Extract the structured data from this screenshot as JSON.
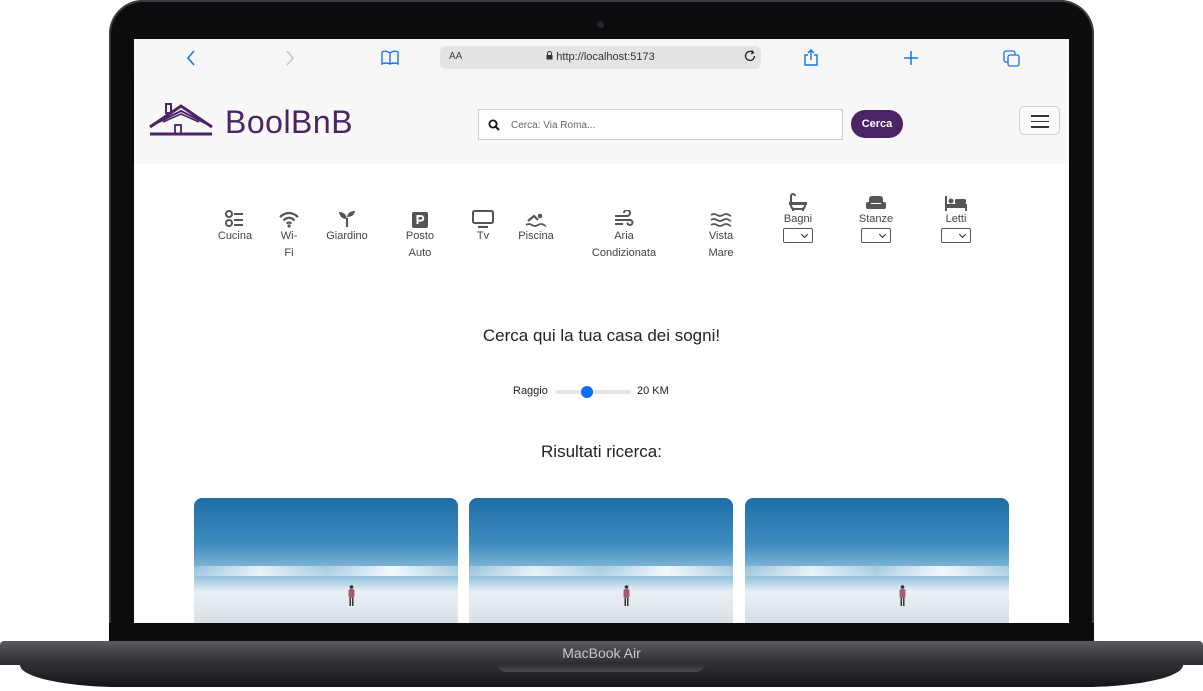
{
  "device": {
    "model": "MacBook Air"
  },
  "browser": {
    "url": "http://localhost:5173",
    "text_size_label": "AA"
  },
  "navbar": {
    "brand": "BoolBnB",
    "search_placeholder": "Cerca: Via Roma...",
    "search_button": "Cerca"
  },
  "filters": {
    "services": [
      {
        "lines": [
          "Cucina"
        ],
        "icon": "kitchen-icon"
      },
      {
        "lines": [
          "Wi-",
          "Fi"
        ],
        "icon": "wifi-icon"
      },
      {
        "lines": [
          "Giardino"
        ],
        "icon": "seedling-icon"
      },
      {
        "lines": [
          "Posto",
          "Auto"
        ],
        "icon": "parking-icon"
      },
      {
        "lines": [
          "Tv"
        ],
        "icon": "tv-icon"
      },
      {
        "lines": [
          "Piscina"
        ],
        "icon": "swimmer-icon"
      },
      {
        "lines": [
          "Aria",
          "Condizionata"
        ],
        "icon": "wind-icon"
      },
      {
        "lines": [
          "Vista",
          "Mare"
        ],
        "icon": "water-icon"
      }
    ],
    "selects": [
      {
        "label": "Bagni",
        "icon": "bath-icon",
        "value": ""
      },
      {
        "label": "Stanze",
        "icon": "couch-icon",
        "value": ""
      },
      {
        "label": "Letti",
        "icon": "bed-icon",
        "value": ""
      }
    ]
  },
  "main": {
    "headline": "Cerca qui la tua casa dei sogni!",
    "radius": {
      "label": "Raggio",
      "value_text": "20 KM",
      "fraction": 0.4
    },
    "results_title": "Risultati ricerca:"
  },
  "results": {
    "card_count": 3,
    "image_description": "person-on-salt-flat"
  },
  "colors": {
    "brand": "#4b2466",
    "accent": "#0d6efd",
    "safari_blue": "#1a73e8"
  }
}
